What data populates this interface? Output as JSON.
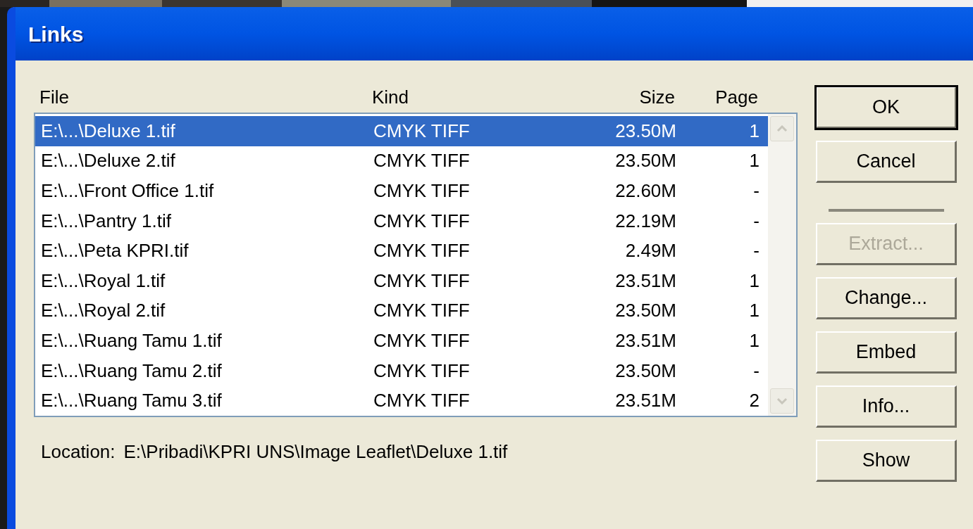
{
  "window": {
    "title": "Links"
  },
  "table": {
    "columns": [
      "File",
      "Kind",
      "Size",
      "Page"
    ],
    "rows": [
      {
        "cells": [
          "E:\\...\\Deluxe 1.tif",
          "CMYK TIFF",
          "23.50M",
          "1"
        ],
        "selected": true
      },
      {
        "cells": [
          "E:\\...\\Deluxe 2.tif",
          "CMYK TIFF",
          "23.50M",
          "1"
        ],
        "selected": false
      },
      {
        "cells": [
          "E:\\...\\Front Office 1.tif",
          "CMYK TIFF",
          "22.60M",
          "-"
        ],
        "selected": false
      },
      {
        "cells": [
          "E:\\...\\Pantry 1.tif",
          "CMYK TIFF",
          "22.19M",
          "-"
        ],
        "selected": false
      },
      {
        "cells": [
          "E:\\...\\Peta KPRI.tif",
          "CMYK TIFF",
          "2.49M",
          "-"
        ],
        "selected": false
      },
      {
        "cells": [
          "E:\\...\\Royal 1.tif",
          "CMYK TIFF",
          "23.51M",
          "1"
        ],
        "selected": false
      },
      {
        "cells": [
          "E:\\...\\Royal 2.tif",
          "CMYK TIFF",
          "23.50M",
          "1"
        ],
        "selected": false
      },
      {
        "cells": [
          "E:\\...\\Ruang Tamu 1.tif",
          "CMYK TIFF",
          "23.51M",
          "1"
        ],
        "selected": false
      },
      {
        "cells": [
          "E:\\...\\Ruang Tamu 2.tif",
          "CMYK TIFF",
          "23.50M",
          "-"
        ],
        "selected": false
      },
      {
        "cells": [
          "E:\\...\\Ruang Tamu 3.tif",
          "CMYK TIFF",
          "23.51M",
          "2"
        ],
        "selected": false
      }
    ]
  },
  "location": {
    "label": "Location:",
    "path": "E:\\Pribadi\\KPRI UNS\\Image Leaflet\\Deluxe 1.tif"
  },
  "buttons": [
    {
      "kind": "button",
      "label": "OK",
      "default": true,
      "disabled": false
    },
    {
      "kind": "button",
      "label": "Cancel",
      "default": false,
      "disabled": false
    },
    {
      "kind": "separator"
    },
    {
      "kind": "button",
      "label": "Extract...",
      "default": false,
      "disabled": true
    },
    {
      "kind": "button",
      "label": "Change...",
      "default": false,
      "disabled": false
    },
    {
      "kind": "button",
      "label": "Embed",
      "default": false,
      "disabled": false
    },
    {
      "kind": "button",
      "label": "Info...",
      "default": false,
      "disabled": false
    },
    {
      "kind": "button",
      "label": "Show",
      "default": false,
      "disabled": false
    }
  ]
}
